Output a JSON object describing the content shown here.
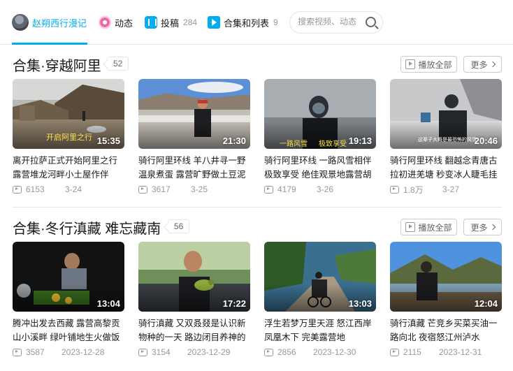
{
  "nav": {
    "home": "赵朔西行漫记",
    "dynamic": "动态",
    "post": "投稿",
    "post_count": "284",
    "collections": "合集和列表",
    "collections_count": "9",
    "search_placeholder": "搜索视频、动态"
  },
  "sections": [
    {
      "title": "合集·穿越阿里",
      "count": "52",
      "play_all": "播放全部",
      "more": "更多",
      "videos": [
        {
          "title": "离开拉萨正式开始阿里之行 露营堆龙河畔小土屋作伴",
          "duration": "15:35",
          "views": "6153",
          "date": "3-24",
          "overlay": "开启阿里之行"
        },
        {
          "title": "骑行阿里环线 羊八井寻一野温泉煮蛋 露营旷野做土豆泥拌饭",
          "duration": "21:30",
          "views": "3617",
          "date": "3-25"
        },
        {
          "title": "骑行阿里环线 一路风雪相伴极致享受 绝佳观景地露营胡萝卜",
          "duration": "19:13",
          "views": "4179",
          "date": "3-26",
          "overlay": "一路风雪",
          "overlay2": "极致享受"
        },
        {
          "title": "骑行阿里环线 翻越念青唐古拉初进羌塘 秒变冰人睫毛挂冰",
          "duration": "20:46",
          "views": "1.8万",
          "date": "3-27",
          "overlay": "这辈子大概是最恐怖的风雪"
        }
      ]
    },
    {
      "title": "合集·冬行滇藏 难忘藏南",
      "count": "56",
      "play_all": "播放全部",
      "more": "更多",
      "videos": [
        {
          "title": "腾冲出发去西藏 露营高黎贡山小溪畔 绿叶铺地生火做饭",
          "duration": "13:04",
          "views": "3587",
          "date": "2023-12-28"
        },
        {
          "title": "骑行滇藏 又双叒叕是认识新物种的一天 路边闭目养神的小鸟",
          "duration": "17:22",
          "views": "3154",
          "date": "2023-12-29"
        },
        {
          "title": "浮生若梦万里天涯 怒江西岸凤凰木下 完美露营地",
          "duration": "13:03",
          "views": "2856",
          "date": "2023-12-30"
        },
        {
          "title": "骑行滇藏 芒竞乡买菜买油一路向北 夜宿怒江州泸水",
          "duration": "12:04",
          "views": "2115",
          "date": "2023-12-31"
        }
      ]
    }
  ]
}
